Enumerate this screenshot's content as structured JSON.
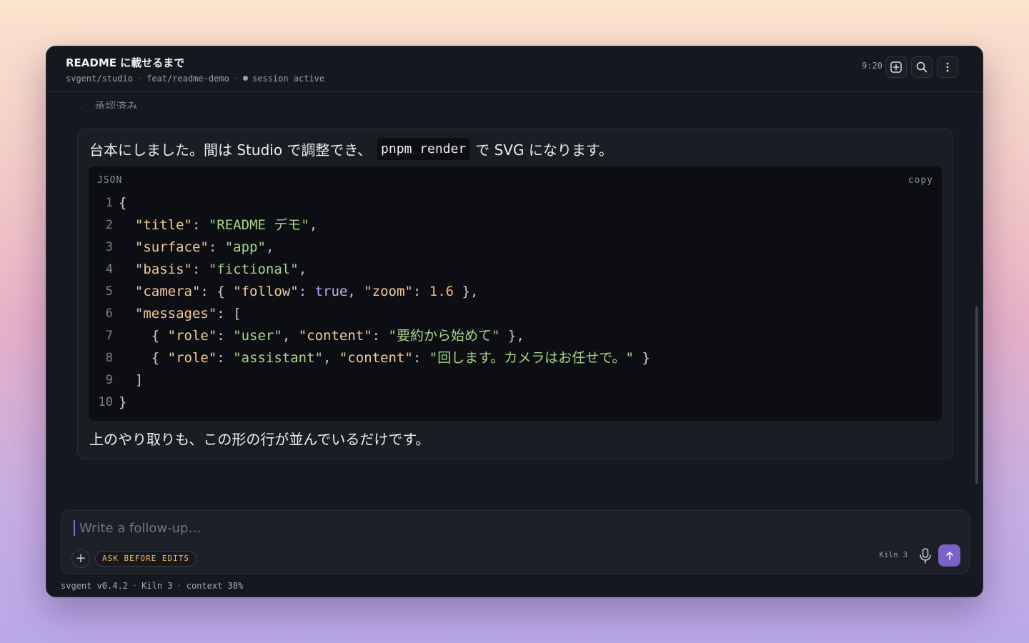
{
  "header": {
    "title": "README に載せるまで",
    "repo": "svgent/studio",
    "branch": "feat/readme-demo",
    "session_status": "session active",
    "time": "9:20"
  },
  "collapsed_section": {
    "label": "承認済み"
  },
  "message": {
    "text_before_code": "台本にしました。間は Studio で調整でき、",
    "inline_code": "pnpm render",
    "text_after_code": "で SVG になります。",
    "code_block": {
      "language": "JSON",
      "copy_label": "copy",
      "lines": [
        {
          "num": "1",
          "tokens": [
            {
              "t": "p",
              "v": "{"
            }
          ]
        },
        {
          "num": "2",
          "tokens": [
            {
              "t": "p",
              "v": "  "
            },
            {
              "t": "k",
              "v": "\"title\""
            },
            {
              "t": "p",
              "v": ": "
            },
            {
              "t": "s",
              "v": "\"README デモ\""
            },
            {
              "t": "p",
              "v": ","
            }
          ]
        },
        {
          "num": "3",
          "tokens": [
            {
              "t": "p",
              "v": "  "
            },
            {
              "t": "k",
              "v": "\"surface\""
            },
            {
              "t": "p",
              "v": ": "
            },
            {
              "t": "s",
              "v": "\"app\""
            },
            {
              "t": "p",
              "v": ","
            }
          ]
        },
        {
          "num": "4",
          "tokens": [
            {
              "t": "p",
              "v": "  "
            },
            {
              "t": "k",
              "v": "\"basis\""
            },
            {
              "t": "p",
              "v": ": "
            },
            {
              "t": "s",
              "v": "\"fictional\""
            },
            {
              "t": "p",
              "v": ","
            }
          ]
        },
        {
          "num": "5",
          "tokens": [
            {
              "t": "p",
              "v": "  "
            },
            {
              "t": "k",
              "v": "\"camera\""
            },
            {
              "t": "p",
              "v": ": { "
            },
            {
              "t": "k",
              "v": "\"follow\""
            },
            {
              "t": "p",
              "v": ": "
            },
            {
              "t": "b",
              "v": "true"
            },
            {
              "t": "p",
              "v": ", "
            },
            {
              "t": "k",
              "v": "\"zoom\""
            },
            {
              "t": "p",
              "v": ": "
            },
            {
              "t": "n",
              "v": "1.6"
            },
            {
              "t": "p",
              "v": " },"
            }
          ]
        },
        {
          "num": "6",
          "tokens": [
            {
              "t": "p",
              "v": "  "
            },
            {
              "t": "k",
              "v": "\"messages\""
            },
            {
              "t": "p",
              "v": ": ["
            }
          ]
        },
        {
          "num": "7",
          "tokens": [
            {
              "t": "p",
              "v": "    { "
            },
            {
              "t": "k",
              "v": "\"role\""
            },
            {
              "t": "p",
              "v": ": "
            },
            {
              "t": "s",
              "v": "\"user\""
            },
            {
              "t": "p",
              "v": ", "
            },
            {
              "t": "k",
              "v": "\"content\""
            },
            {
              "t": "p",
              "v": ": "
            },
            {
              "t": "s",
              "v": "\"要約から始めて\""
            },
            {
              "t": "p",
              "v": " },"
            }
          ]
        },
        {
          "num": "8",
          "tokens": [
            {
              "t": "p",
              "v": "    { "
            },
            {
              "t": "k",
              "v": "\"role\""
            },
            {
              "t": "p",
              "v": ": "
            },
            {
              "t": "s",
              "v": "\"assistant\""
            },
            {
              "t": "p",
              "v": ", "
            },
            {
              "t": "k",
              "v": "\"content\""
            },
            {
              "t": "p",
              "v": ": "
            },
            {
              "t": "s",
              "v": "\"回します。カメラはお任せで。\""
            },
            {
              "t": "p",
              "v": " }"
            }
          ]
        },
        {
          "num": "9",
          "tokens": [
            {
              "t": "p",
              "v": "  ]"
            }
          ]
        },
        {
          "num": "10",
          "tokens": [
            {
              "t": "p",
              "v": "}"
            }
          ]
        }
      ]
    },
    "text_after_block": "上のやり取りも、この形の行が並んでいるだけです。"
  },
  "composer": {
    "placeholder": "Write a follow-up…",
    "value": "",
    "mode_chip": "ASK BEFORE EDITS",
    "model": "Kiln 3"
  },
  "statusbar": {
    "version": "svgent v0.4.2",
    "model": "Kiln 3",
    "context": "context 38%"
  },
  "colors": {
    "accent": "#7b62c9",
    "chip_text": "#f0b561",
    "string": "#a8d58c",
    "key": "#f2c99a",
    "boolean": "#c9a7f2",
    "number": "#f1b56b"
  },
  "icons": {
    "new_session": "plus-square-icon",
    "search": "search-icon",
    "more": "more-vertical-icon",
    "collapse": "chevron-down-icon",
    "attach": "plus-icon",
    "mic": "microphone-icon",
    "send": "arrow-up-icon"
  }
}
